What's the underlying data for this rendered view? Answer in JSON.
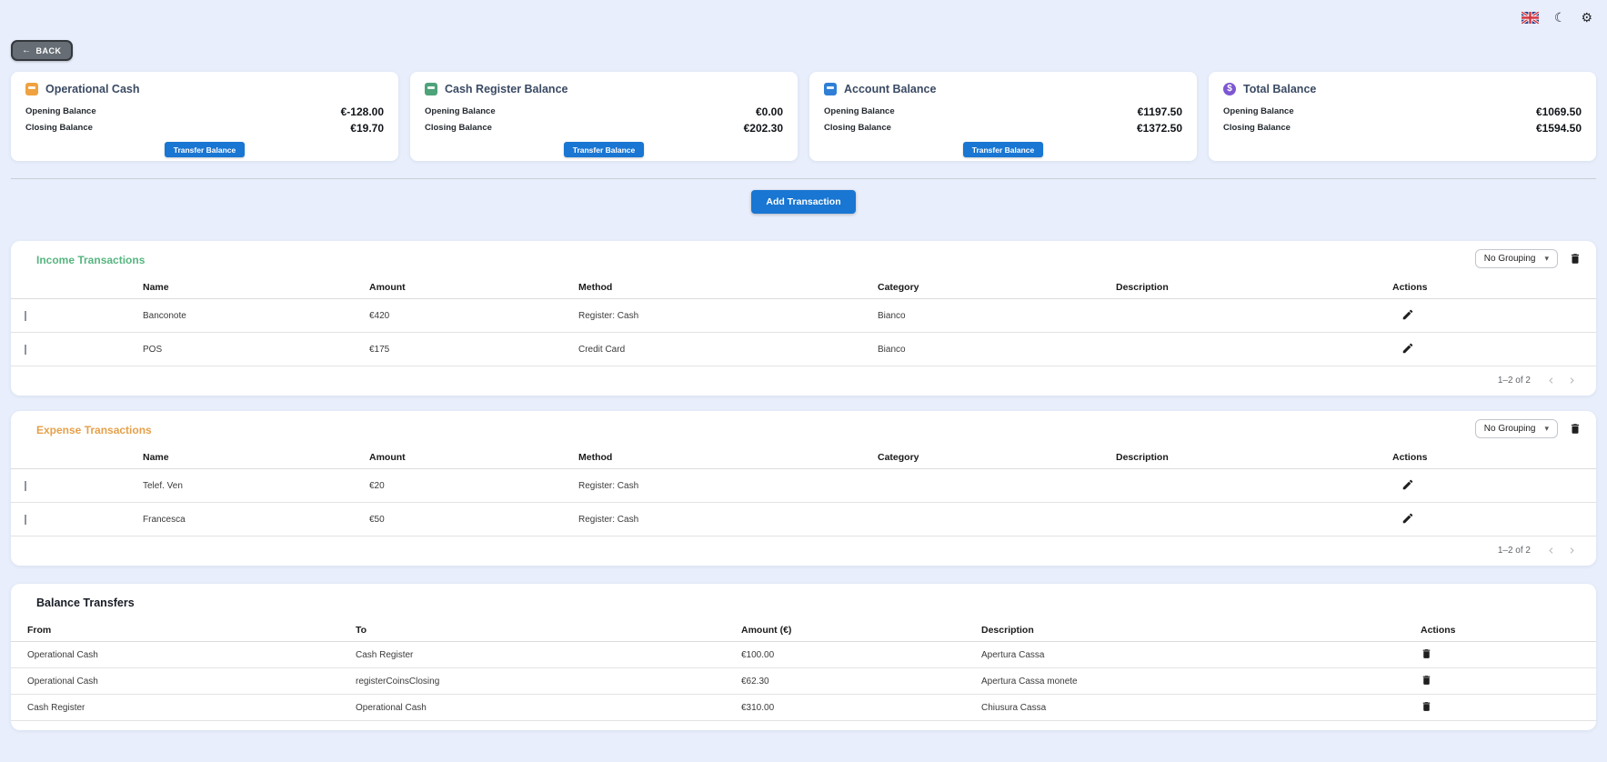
{
  "topbar": {
    "language_icon": "uk-flag",
    "moon_glyph": "☾",
    "gear_glyph": "⚙"
  },
  "back_button": {
    "arrow": "←",
    "label": "BACK"
  },
  "cards": [
    {
      "title": "Operational Cash",
      "icon": "cash-square-orange",
      "icon_color": "#efa23f",
      "opening_label": "Opening Balance",
      "opening_value": "€-128.00",
      "closing_label": "Closing Balance",
      "closing_value": "€19.70",
      "button_label": "Transfer Balance"
    },
    {
      "title": "Cash Register Balance",
      "icon": "register-square-green",
      "icon_color": "#4da37a",
      "opening_label": "Opening Balance",
      "opening_value": "€0.00",
      "closing_label": "Closing Balance",
      "closing_value": "€202.30",
      "button_label": "Transfer Balance"
    },
    {
      "title": "Account Balance",
      "icon": "account-square-blue",
      "icon_color": "#2f7fd6",
      "opening_label": "Opening Balance",
      "opening_value": "€1197.50",
      "closing_label": "Closing Balance",
      "closing_value": "€1372.50",
      "button_label": "Transfer Balance"
    },
    {
      "title": "Total Balance",
      "icon": "dollar-circle-purple",
      "icon_color": "#7d57d2",
      "opening_label": "Opening Balance",
      "opening_value": "€1069.50",
      "closing_label": "Closing Balance",
      "closing_value": "€1594.50"
    }
  ],
  "add_transaction": {
    "label": "Add Transaction"
  },
  "income": {
    "title": "Income Transactions",
    "title_color": "#57b580",
    "grouping_value": "No Grouping",
    "columns": [
      "Name",
      "Amount",
      "Method",
      "Category",
      "Description",
      "Actions"
    ],
    "rows": [
      {
        "name": "Banconote",
        "amount": "€420",
        "method": "Register: Cash",
        "category": "Bianco",
        "description": ""
      },
      {
        "name": "POS",
        "amount": "€175",
        "method": "Credit Card",
        "category": "Bianco",
        "description": ""
      }
    ],
    "pagination": "1–2 of 2"
  },
  "expense": {
    "title": "Expense Transactions",
    "title_color": "#e5a04a",
    "grouping_value": "No Grouping",
    "columns": [
      "Name",
      "Amount",
      "Method",
      "Category",
      "Description",
      "Actions"
    ],
    "rows": [
      {
        "name": "Telef. Ven",
        "amount": "€20",
        "method": "Register: Cash",
        "category": "",
        "description": ""
      },
      {
        "name": "Francesca",
        "amount": "€50",
        "method": "Register: Cash",
        "category": "",
        "description": ""
      }
    ],
    "pagination": "1–2 of 2"
  },
  "transfers": {
    "title": "Balance Transfers",
    "columns": [
      "From",
      "To",
      "Amount (€)",
      "Description",
      "Actions"
    ],
    "rows": [
      {
        "from": "Operational Cash",
        "to": "Cash Register",
        "amount": "€100.00",
        "description": "Apertura Cassa"
      },
      {
        "from": "Operational Cash",
        "to": "registerCoinsClosing",
        "amount": "€62.30",
        "description": "Apertura Cassa monete"
      },
      {
        "from": "Cash Register",
        "to": "Operational Cash",
        "amount": "€310.00",
        "description": "Chiusura Cassa"
      }
    ]
  },
  "colors": {
    "page_background": "#e8eefb",
    "accent_blue": "#1976d2",
    "income_green": "#57b580",
    "expense_orange": "#e5a04a"
  }
}
